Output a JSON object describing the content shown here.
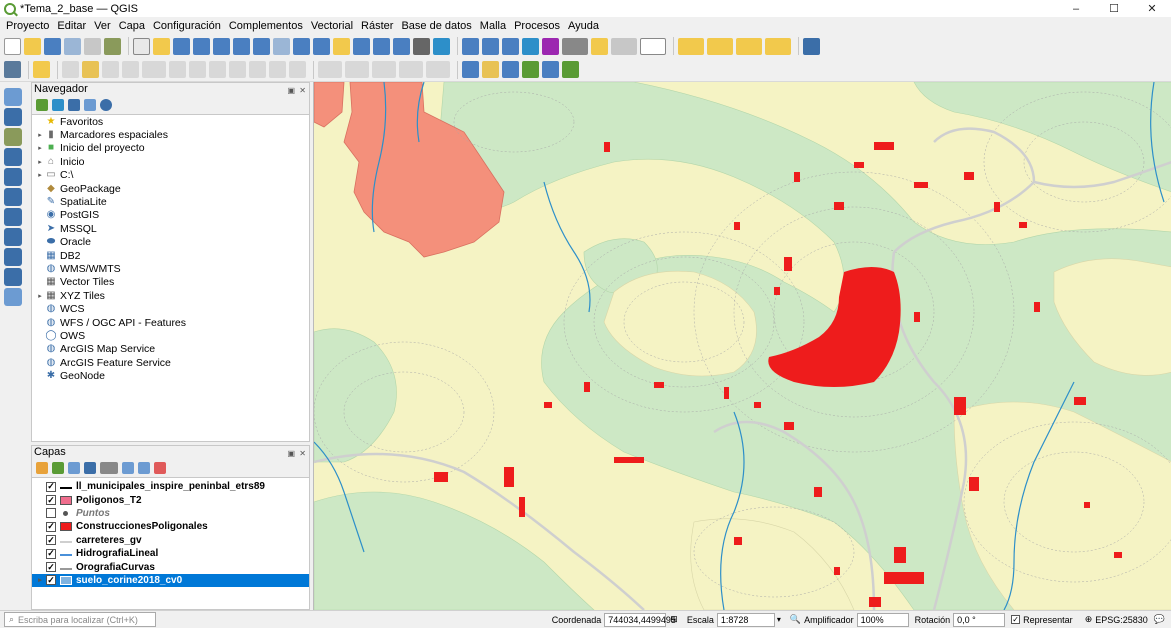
{
  "window": {
    "title": "*Tema_2_base — QGIS",
    "minimize": "–",
    "maximize": "☐",
    "close": "✕"
  },
  "menu": [
    "Proyecto",
    "Editar",
    "Ver",
    "Capa",
    "Configuración",
    "Complementos",
    "Vectorial",
    "Ráster",
    "Base de datos",
    "Malla",
    "Procesos",
    "Ayuda"
  ],
  "navigator": {
    "title": "Navegador",
    "items": [
      {
        "label": "Favoritos",
        "icon": "star-icon",
        "glyph": "★",
        "color": "#e6b800",
        "arrow": ""
      },
      {
        "label": "Marcadores espaciales",
        "icon": "bookmark-icon",
        "glyph": "▮",
        "color": "#6b6b6b",
        "arrow": "▸"
      },
      {
        "label": "Inicio del proyecto",
        "icon": "project-home-icon",
        "glyph": "■",
        "color": "#4caf50",
        "arrow": "▸"
      },
      {
        "label": "Inicio",
        "icon": "home-folder-icon",
        "glyph": "⌂",
        "color": "#777777",
        "arrow": "▸"
      },
      {
        "label": "C:\\",
        "icon": "drive-icon",
        "glyph": "▭",
        "color": "#777777",
        "arrow": "▸"
      },
      {
        "label": "GeoPackage",
        "icon": "geopackage-icon",
        "glyph": "◆",
        "color": "#b08a3c",
        "arrow": ""
      },
      {
        "label": "SpatiaLite",
        "icon": "spatialite-icon",
        "glyph": "✎",
        "color": "#3b6ea8",
        "arrow": ""
      },
      {
        "label": "PostGIS",
        "icon": "postgis-icon",
        "glyph": "◉",
        "color": "#3b6ea8",
        "arrow": ""
      },
      {
        "label": "MSSQL",
        "icon": "mssql-icon",
        "glyph": "➤",
        "color": "#3b6ea8",
        "arrow": ""
      },
      {
        "label": "Oracle",
        "icon": "oracle-icon",
        "glyph": "⬬",
        "color": "#3b6ea8",
        "arrow": ""
      },
      {
        "label": "DB2",
        "icon": "db2-icon",
        "glyph": "▦",
        "color": "#3b6ea8",
        "arrow": ""
      },
      {
        "label": "WMS/WMTS",
        "icon": "wms-icon",
        "glyph": "◍",
        "color": "#3b6ea8",
        "arrow": ""
      },
      {
        "label": "Vector Tiles",
        "icon": "vector-tiles-icon",
        "glyph": "▦",
        "color": "#555555",
        "arrow": ""
      },
      {
        "label": "XYZ Tiles",
        "icon": "xyz-tiles-icon",
        "glyph": "▦",
        "color": "#555555",
        "arrow": "▸"
      },
      {
        "label": "WCS",
        "icon": "wcs-icon",
        "glyph": "◍",
        "color": "#3b6ea8",
        "arrow": ""
      },
      {
        "label": "WFS / OGC API - Features",
        "icon": "wfs-icon",
        "glyph": "◍",
        "color": "#3b6ea8",
        "arrow": ""
      },
      {
        "label": "OWS",
        "icon": "ows-icon",
        "glyph": "◯",
        "color": "#3b6ea8",
        "arrow": ""
      },
      {
        "label": "ArcGIS Map Service",
        "icon": "arcgis-map-icon",
        "glyph": "◍",
        "color": "#3b6ea8",
        "arrow": ""
      },
      {
        "label": "ArcGIS Feature Service",
        "icon": "arcgis-feature-icon",
        "glyph": "◍",
        "color": "#3b6ea8",
        "arrow": ""
      },
      {
        "label": "GeoNode",
        "icon": "geonode-icon",
        "glyph": "✱",
        "color": "#3b6ea8",
        "arrow": ""
      }
    ]
  },
  "layers": {
    "title": "Capas",
    "items": [
      {
        "label": "ll_municipales_inspire_peninbal_etrs89",
        "checked": true,
        "symbol": "line",
        "color": "#000000",
        "style": ""
      },
      {
        "label": "Poligonos_T2",
        "checked": true,
        "symbol": "fill",
        "color": "#f06d8d",
        "style": ""
      },
      {
        "label": "Puntos",
        "checked": false,
        "symbol": "dot",
        "color": "#555555",
        "style": "italic"
      },
      {
        "label": "ConstruccionesPoligonales",
        "checked": true,
        "symbol": "fill",
        "color": "#ee1c1c",
        "style": ""
      },
      {
        "label": "carreteres_gv",
        "checked": true,
        "symbol": "line",
        "color": "#cfcfcf",
        "style": ""
      },
      {
        "label": "HidrografiaLineal",
        "checked": true,
        "symbol": "line",
        "color": "#4a90d9",
        "style": ""
      },
      {
        "label": "OrografiaCurvas",
        "checked": true,
        "symbol": "dashed",
        "color": "#999999",
        "style": ""
      },
      {
        "label": "suelo_corine2018_cv0",
        "checked": true,
        "symbol": "raster",
        "color": "#7fb3e0",
        "style": "selected"
      }
    ]
  },
  "statusbar": {
    "locator_placeholder": "Escriba para localizar (Ctrl+K)",
    "coord_label": "Coordenada",
    "coord_value": "744034,4499495",
    "scale_label": "Escala",
    "scale_value": "1:8728",
    "magnifier_label": "Amplificador",
    "magnifier_value": "100%",
    "rotation_label": "Rotación",
    "rotation_value": "0,0 °",
    "render_label": "Representar",
    "crs": "EPSG:25830"
  },
  "colors": {
    "map_background": "#f5f3c4",
    "forest_green": "#cde8c5",
    "orange_polygon": "#f4907b",
    "buildings": "#ee1c1c",
    "rivers": "#2d8fc9",
    "contours": "#9a9a9a",
    "roads": "#d5d5d5",
    "selection": "#0078d7"
  }
}
